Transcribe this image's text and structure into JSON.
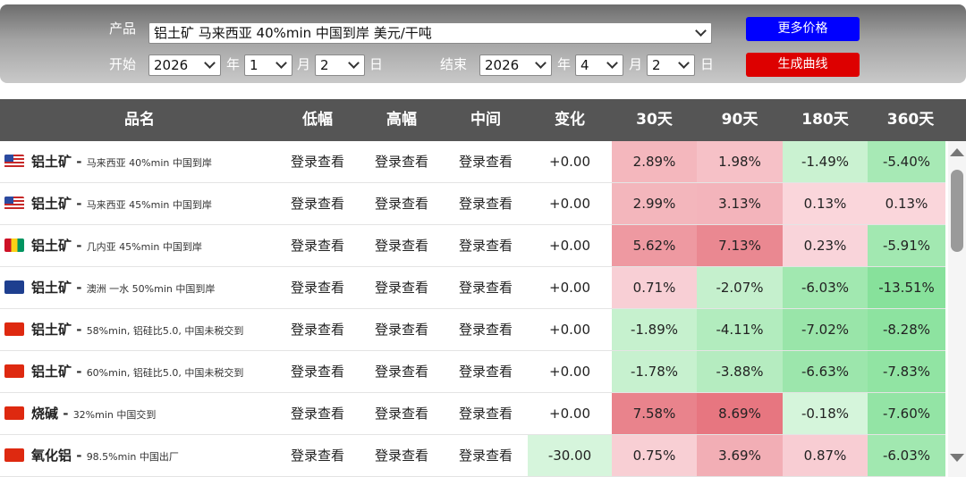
{
  "filters": {
    "product_label": "产品",
    "product_value": "铝土矿 马来西亚 40%min 中国到岸 美元/干吨",
    "start_label": "开始",
    "end_label": "结束",
    "year_unit": "年",
    "month_unit": "月",
    "day_unit": "日",
    "start_year": "2026",
    "start_month": "1",
    "start_day": "2",
    "end_year": "2026",
    "end_month": "4",
    "end_day": "2",
    "more_price_button": "更多价格",
    "more_price_color": "#0000ff",
    "generate_curve_button": "生成曲线",
    "generate_curve_color": "#dd0000"
  },
  "table": {
    "headers": [
      "品名",
      "低幅",
      "高幅",
      "中间",
      "变化",
      "30天",
      "90天",
      "180天",
      "360天"
    ],
    "rows": [
      {
        "flag": "us",
        "name": "铝土矿",
        "desc": "马来西亚 40%min 中国到岸",
        "low": "登录查看",
        "high": "登录查看",
        "mid": "登录查看",
        "change": "+0.00",
        "d30": "2.89%",
        "d90": "1.98%",
        "d180": "-1.49%",
        "d360": "-5.40%"
      },
      {
        "flag": "us",
        "name": "铝土矿",
        "desc": "马来西亚 45%min 中国到岸",
        "low": "登录查看",
        "high": "登录查看",
        "mid": "登录查看",
        "change": "+0.00",
        "d30": "2.99%",
        "d90": "3.13%",
        "d180": "0.13%",
        "d360": "0.13%"
      },
      {
        "flag": "gn",
        "name": "铝土矿",
        "desc": "几内亚 45%min 中国到岸",
        "low": "登录查看",
        "high": "登录查看",
        "mid": "登录查看",
        "change": "+0.00",
        "d30": "5.62%",
        "d90": "7.13%",
        "d180": "0.23%",
        "d360": "-5.91%"
      },
      {
        "flag": "au",
        "name": "铝土矿",
        "desc": "澳洲 一水 50%min 中国到岸",
        "low": "登录查看",
        "high": "登录查看",
        "mid": "登录查看",
        "change": "+0.00",
        "d30": "0.71%",
        "d90": "-2.07%",
        "d180": "-6.03%",
        "d360": "-13.51%"
      },
      {
        "flag": "cn",
        "name": "铝土矿",
        "desc": "58%min, 铝硅比5.0, 中国未税交到",
        "low": "登录查看",
        "high": "登录查看",
        "mid": "登录查看",
        "change": "+0.00",
        "d30": "-1.89%",
        "d90": "-4.11%",
        "d180": "-7.02%",
        "d360": "-8.28%"
      },
      {
        "flag": "cn",
        "name": "铝土矿",
        "desc": "60%min, 铝硅比5.0, 中国未税交到",
        "low": "登录查看",
        "high": "登录查看",
        "mid": "登录查看",
        "change": "+0.00",
        "d30": "-1.78%",
        "d90": "-3.88%",
        "d180": "-6.63%",
        "d360": "-7.83%"
      },
      {
        "flag": "cn",
        "name": "烧碱",
        "desc": "32%min 中国交到",
        "low": "登录查看",
        "high": "登录查看",
        "mid": "登录查看",
        "change": "+0.00",
        "d30": "7.58%",
        "d90": "8.69%",
        "d180": "-0.18%",
        "d360": "-7.60%"
      },
      {
        "flag": "cn",
        "name": "氧化铝",
        "desc": "98.5%min 中国出厂",
        "low": "登录查看",
        "high": "登录查看",
        "mid": "登录查看",
        "change": "-30.00",
        "d30": "0.75%",
        "d90": "3.69%",
        "d180": "0.87%",
        "d360": "-6.03%"
      }
    ]
  }
}
